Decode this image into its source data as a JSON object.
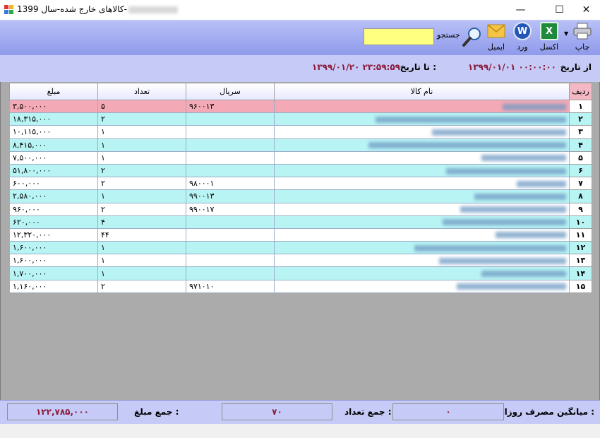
{
  "window": {
    "title_left": "کالاهای خارج شده-سال 1399-",
    "minimize": "—",
    "maximize": "☐",
    "close": "✕"
  },
  "toolbar": {
    "print_label": "چاپ",
    "excel_label": "اکسل",
    "word_label": "ورد",
    "email_label": "ایمیل",
    "search_label": "جستجو",
    "search_value": ""
  },
  "dates": {
    "from_label": "از تاریخ",
    "from_value": "۱۳۹۹/۰۱/۰۱ ۰۰:۰۰:۰۰",
    "to_label": "تا تاریخ :",
    "to_value": "۱۳۹۹/۰۱/۲۰ ۲۳:۵۹:۵۹"
  },
  "table": {
    "columns": {
      "index": "ردیف",
      "name": "نام کالا",
      "serial": "سریال",
      "count": "تعداد",
      "amount": "مبلغ"
    },
    "rows": [
      {
        "index": "۱",
        "serial": "۹۶۰۰۱۳",
        "count": "۵",
        "amount": "۳,۵۰۰,۰۰۰"
      },
      {
        "index": "۲",
        "serial": "",
        "count": "۲",
        "amount": "۱۸,۳۱۵,۰۰۰"
      },
      {
        "index": "۳",
        "serial": "",
        "count": "۱",
        "amount": "۱۰,۱۱۵,۰۰۰"
      },
      {
        "index": "۴",
        "serial": "",
        "count": "۱",
        "amount": "۸,۴۱۵,۰۰۰"
      },
      {
        "index": "۵",
        "serial": "",
        "count": "۱",
        "amount": "۷,۵۰۰,۰۰۰"
      },
      {
        "index": "۶",
        "serial": "",
        "count": "۲",
        "amount": "۵۱,۸۰۰,۰۰۰"
      },
      {
        "index": "۷",
        "serial": "۹۸۰۰۰۱",
        "count": "۲",
        "amount": "۶۰۰,۰۰۰"
      },
      {
        "index": "۸",
        "serial": "۹۹۰۰۱۳",
        "count": "۱",
        "amount": "۲,۵۸۰,۰۰۰"
      },
      {
        "index": "۹",
        "serial": "۹۹۰۰۱۷",
        "count": "۲",
        "amount": "۹۶۰,۰۰۰"
      },
      {
        "index": "۱۰",
        "serial": "",
        "count": "۴",
        "amount": "۶۲۰,۰۰۰"
      },
      {
        "index": "۱۱",
        "serial": "",
        "count": "۴۴",
        "amount": "۱۲,۳۲۰,۰۰۰"
      },
      {
        "index": "۱۲",
        "serial": "",
        "count": "۱",
        "amount": "۱,۶۰۰,۰۰۰"
      },
      {
        "index": "۱۳",
        "serial": "",
        "count": "۱",
        "amount": "۱,۶۰۰,۰۰۰"
      },
      {
        "index": "۱۴",
        "serial": "",
        "count": "۱",
        "amount": "۱,۷۰۰,۰۰۰"
      },
      {
        "index": "۱۵",
        "serial": "۹۷۱۰۱۰",
        "count": "۲",
        "amount": "۱,۱۶۰,۰۰۰"
      }
    ]
  },
  "footer": {
    "daily_avg_label": "میانگین مصرف روزانه :",
    "daily_avg_value": "۰",
    "total_count_label": "جمع تعداد :",
    "total_count_value": "۷۰",
    "total_amount_label": "جمع مبلغ :",
    "total_amount_value": "۱۲۲,۷۸۵,۰۰۰"
  },
  "colors": {
    "toolbar": "#9fa9ef",
    "header_band": "#c6caf6",
    "selected_row": "#f4a9b6",
    "alt_row": "#b9f4f4",
    "value_text": "#8b1a3a"
  }
}
